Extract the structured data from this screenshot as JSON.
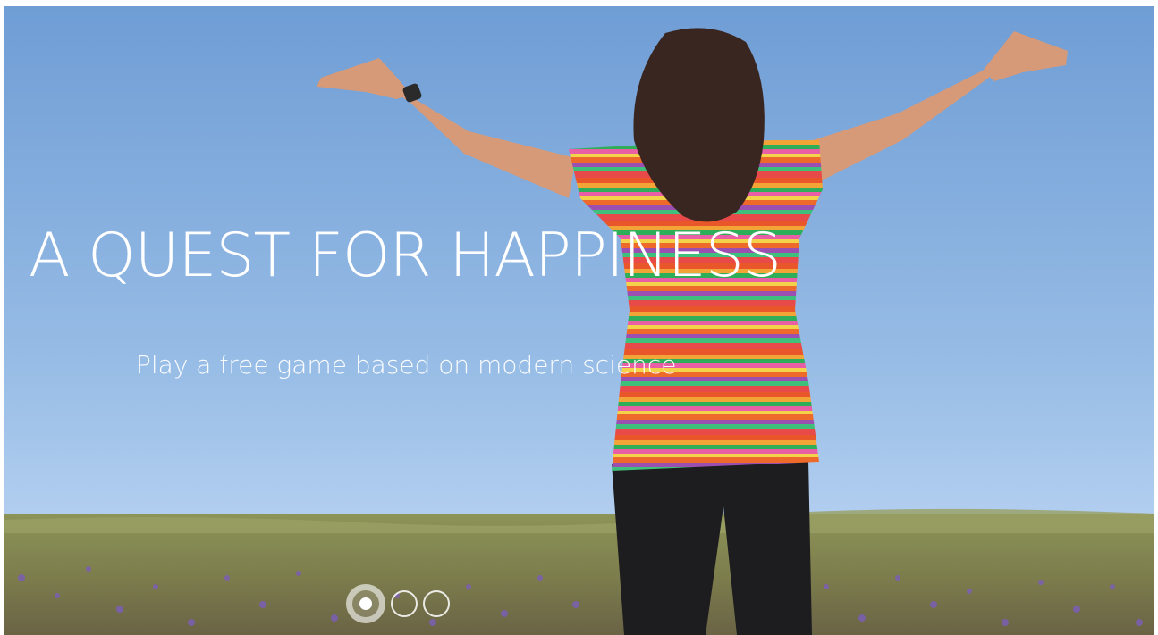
{
  "hero": {
    "title": "A QUEST FOR HAPPINESS",
    "subtitle": "Play a free game based on modern science"
  },
  "carousel": {
    "slide_count": 3,
    "active_index": 0
  },
  "colors": {
    "sky_top": "#6e9fd6",
    "sky_bottom": "#a9c9ec",
    "field": "#8a8f52",
    "flowers": "#7a5fae",
    "text": "#ffffff"
  }
}
